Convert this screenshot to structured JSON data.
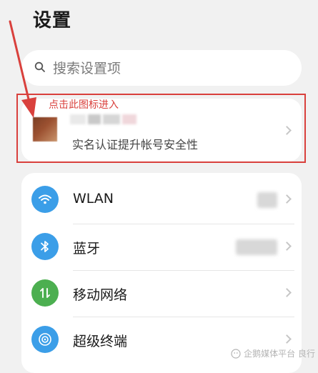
{
  "page": {
    "title": "设置"
  },
  "search": {
    "placeholder": "搜索设置项"
  },
  "annotation": {
    "hint": "点击此图标进入",
    "color": "#d9403c"
  },
  "account": {
    "subtitle": "实名认证提升帐号安全性"
  },
  "settings": {
    "items": [
      {
        "label": "WLAN",
        "icon": "wifi-icon",
        "color": "#3b9ee8"
      },
      {
        "label": "蓝牙",
        "icon": "bluetooth-icon",
        "color": "#3b9ee8"
      },
      {
        "label": "移动网络",
        "icon": "mobile-data-icon",
        "color": "#4caf50"
      },
      {
        "label": "超级终端",
        "icon": "super-device-icon",
        "color": "#3b9ee8"
      }
    ]
  },
  "watermark": {
    "text": "企鹅媒体平台 良行"
  }
}
